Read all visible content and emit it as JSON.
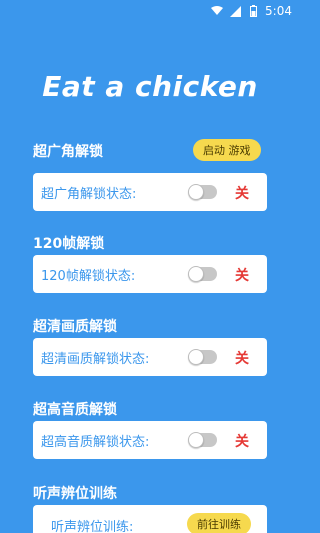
{
  "status": {
    "time": "5:04"
  },
  "title": "Eat a chicken",
  "sections": [
    {
      "title": "超广角解锁",
      "label": "超广角解锁状态:",
      "state": "关",
      "header_button": "启动 游戏"
    },
    {
      "title": "120帧解锁",
      "label": "120帧解锁状态:",
      "state": "关"
    },
    {
      "title": "超清画质解锁",
      "label": "超清画质解锁状态:",
      "state": "关"
    },
    {
      "title": "超高音质解锁",
      "label": "超高音质解锁状态:",
      "state": "关"
    },
    {
      "title": "听声辨位训练",
      "label": "听声辨位训练:",
      "button": "前往训练"
    }
  ],
  "colors": {
    "background": "#3b97ec",
    "accent_button": "#f6d94e",
    "off_state": "#e53935"
  }
}
